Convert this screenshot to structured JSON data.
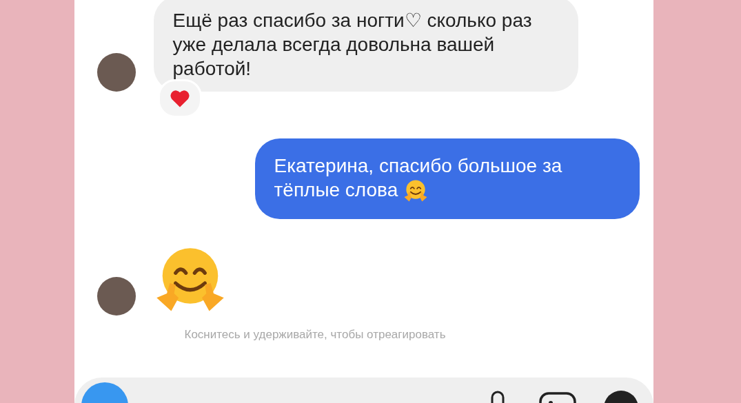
{
  "messages": [
    {
      "kind": "incoming",
      "text": "Ещё раз спасибо за ногти♡ сколько раз уже делала всегда довольна вашей работой!",
      "reaction": true
    },
    {
      "kind": "outgoing",
      "text": "Екатерина, спасибо большое за тёплые слова"
    },
    {
      "kind": "sticker"
    }
  ],
  "hint": "Коснитесь и удерживайте, чтобы отреагировать"
}
